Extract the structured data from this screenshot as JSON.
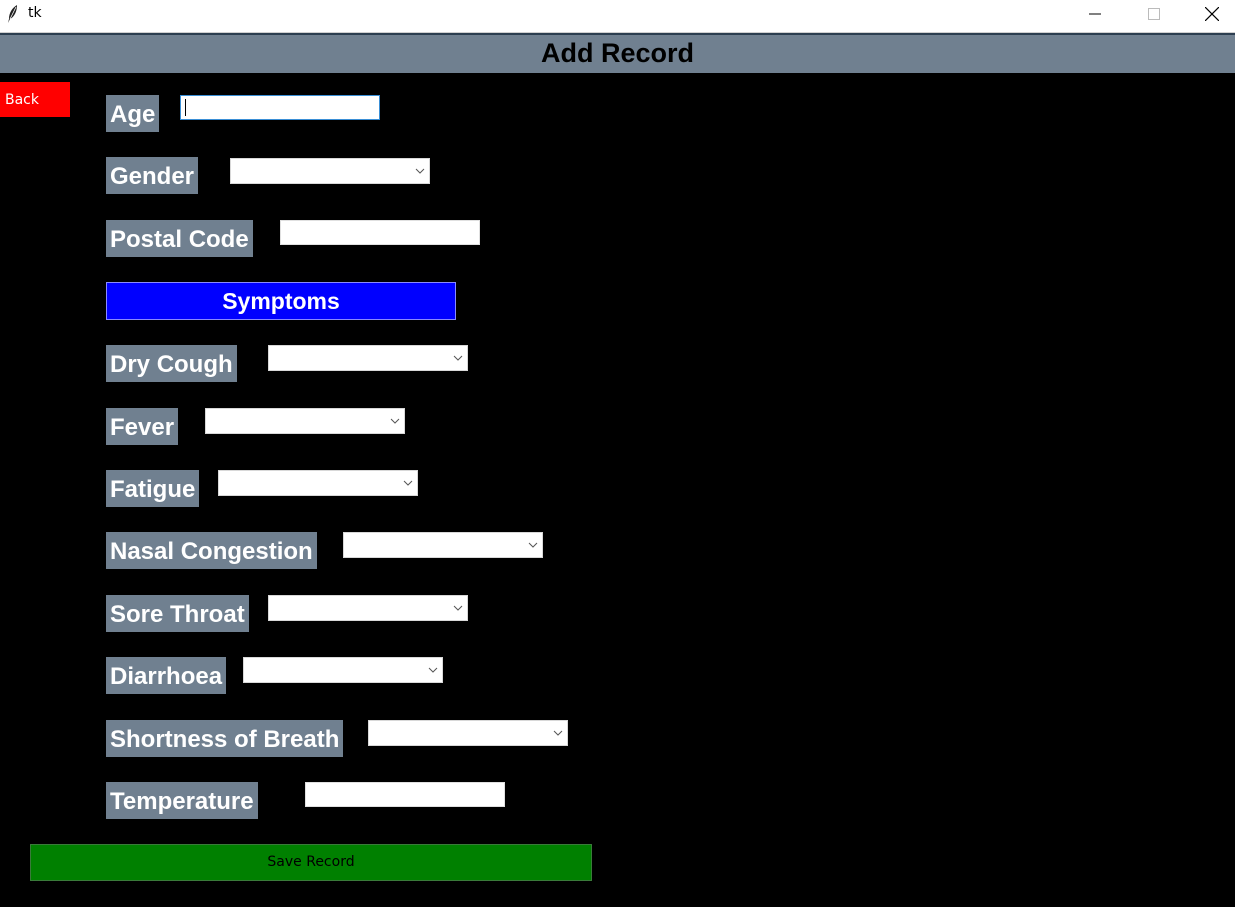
{
  "window": {
    "title": "tk",
    "icon": "feather-icon",
    "controls": [
      "minimize-icon",
      "maximize-icon",
      "close-icon"
    ]
  },
  "header": {
    "title": "Add Record"
  },
  "back_button": {
    "label": "Back"
  },
  "fields": {
    "age": {
      "label": "Age",
      "value": ""
    },
    "gender": {
      "label": "Gender",
      "value": ""
    },
    "postal_code": {
      "label": "Postal Code",
      "value": ""
    }
  },
  "symptoms_section": {
    "label": "Symptoms"
  },
  "symptoms": {
    "dry_cough": {
      "label": "Dry Cough",
      "value": ""
    },
    "fever": {
      "label": "Fever",
      "value": ""
    },
    "fatigue": {
      "label": "Fatigue",
      "value": ""
    },
    "nasal_congestion": {
      "label": "Nasal Congestion",
      "value": ""
    },
    "sore_throat": {
      "label": "Sore Throat",
      "value": ""
    },
    "diarrhoea": {
      "label": "Diarrhoea",
      "value": ""
    },
    "shortness_of_breath": {
      "label": "Shortness of Breath",
      "value": ""
    },
    "temperature": {
      "label": "Temperature",
      "value": ""
    }
  },
  "save_button": {
    "label": "Save Record"
  },
  "colors": {
    "background": "#000000",
    "header_bg": "#708090",
    "label_bg": "#708090",
    "back_button": "#ff0000",
    "symptoms_bg": "#0000ff",
    "save_button": "#008000"
  }
}
